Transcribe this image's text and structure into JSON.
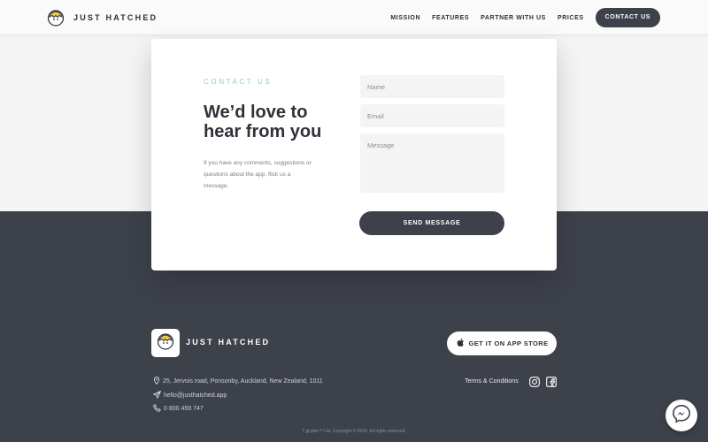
{
  "colors": {
    "dark": "#3d414a",
    "accent": "#8ccfc4",
    "light_bg": "#f4f4f5"
  },
  "header": {
    "brand": "JUST HATCHED",
    "nav": [
      {
        "label": "MISSION"
      },
      {
        "label": "FEATURES"
      },
      {
        "label": "PARTNER WITH US"
      },
      {
        "label": "PRICES"
      }
    ],
    "cta": "CONTACT US"
  },
  "contact": {
    "eyebrow": "CONTACT US",
    "headline": "We’d love to hear from you",
    "description": "If you have any comments, suggestions or questions about the app, flick us a message.",
    "name_placeholder": "Name",
    "email_placeholder": "Email",
    "message_placeholder": "Message",
    "send_label": "SEND MESSAGE"
  },
  "footer": {
    "brand": "JUST HATCHED",
    "appstore_label": "GET IT ON APP STORE",
    "address": "25, Jervois road, Ponsonby, Auckland, New Zealand, 1011",
    "email": "hello@justhatched.app",
    "phone": "0 800 459 747",
    "terms": "Terms & Conditions",
    "copyright": "7 glyphs™ Ltd. Copyright © 2020. All rights reserved.",
    "icons": [
      "map-pin-icon",
      "send-icon",
      "phone-icon",
      "instagram-icon",
      "facebook-icon",
      "apple-icon",
      "messenger-icon"
    ]
  }
}
